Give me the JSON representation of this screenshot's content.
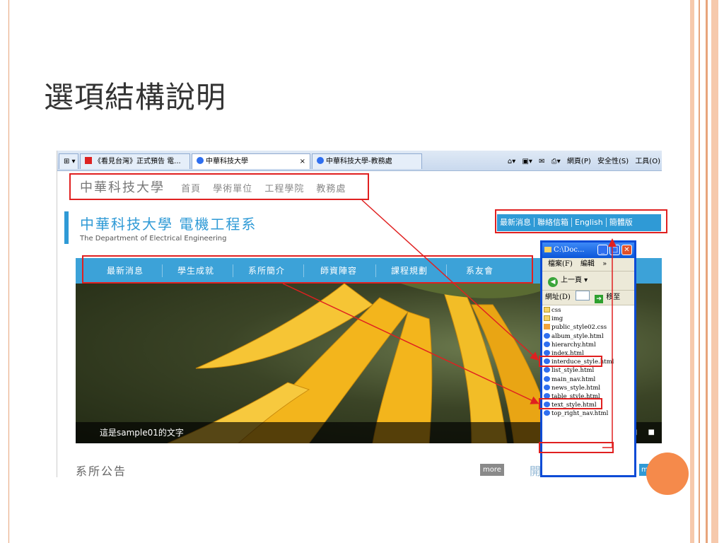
{
  "slide": {
    "title": "選項結構說明",
    "accent_color": "#f58a4b"
  },
  "browser": {
    "tabs": [
      {
        "label": "《看見台灣》正式預告 電..."
      },
      {
        "label": "中華科技大學",
        "close": "×"
      },
      {
        "label": "中華科技大學-教務處"
      }
    ],
    "toolbar": [
      "網頁(P)",
      "安全性(S)",
      "工具(O)"
    ]
  },
  "site": {
    "topnav": {
      "logo": "中華科技大學",
      "items": [
        "首頁",
        "學術單位",
        "工程學院",
        "教務處"
      ]
    },
    "header": {
      "name": "中華科技大學 電機工程系",
      "subtitle": "The Department of Electrical Engineering"
    },
    "top_right_nav": [
      "最新消息",
      "聯絡信箱",
      "English",
      "簡體版"
    ],
    "main_nav": [
      "最新消息",
      "學生成就",
      "系所簡介",
      "師資陣容",
      "課程規劃",
      "系友會"
    ],
    "hero_caption": "這是sample01的文字",
    "hero_dots": "■ ■",
    "notice_title": "系所公告",
    "more_label": "more",
    "notice2_title": "開",
    "primary_color": "#2f9ad6"
  },
  "explorer": {
    "title": "C:\\Doc...",
    "menu": [
      "檔案(F)",
      "編輯",
      "»"
    ],
    "back_label": "上一頁",
    "address_label": "網址(D)",
    "go_label": "移至",
    "files": [
      {
        "name": "css",
        "kind": "folder"
      },
      {
        "name": "img",
        "kind": "folder"
      },
      {
        "name": "public_style02.css",
        "kind": "css"
      },
      {
        "name": "album_style.html",
        "kind": "html"
      },
      {
        "name": "hierarchy.html",
        "kind": "html"
      },
      {
        "name": "index.html",
        "kind": "html"
      },
      {
        "name": "interduce_style.html",
        "kind": "html"
      },
      {
        "name": "list_style.html",
        "kind": "html"
      },
      {
        "name": "main_nav.html",
        "kind": "html"
      },
      {
        "name": "news_style.html",
        "kind": "html"
      },
      {
        "name": "table_style.html",
        "kind": "html"
      },
      {
        "name": "text_style.html",
        "kind": "html"
      },
      {
        "name": "top_right_nav.html",
        "kind": "html"
      }
    ]
  }
}
